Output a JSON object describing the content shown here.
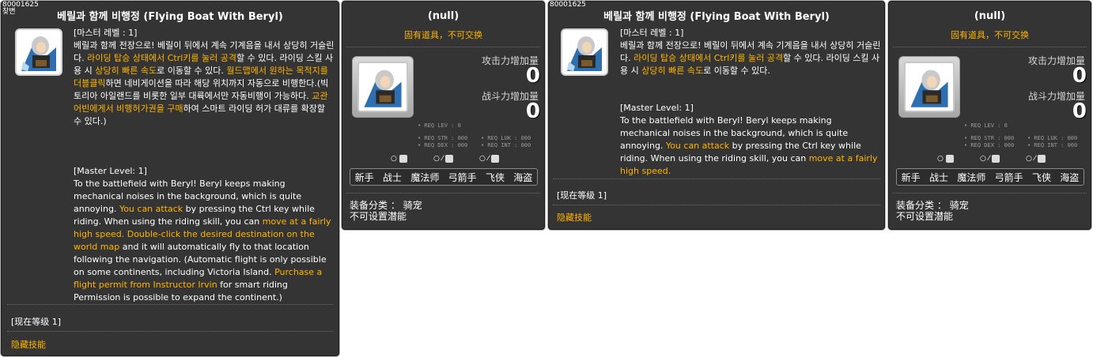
{
  "item_id": "80001625",
  "id_sub": "찾변",
  "skill_name": "베릴과 함께 비행정 (Flying Boat With Beryl)",
  "null_title": "(null)",
  "untradeable": "固有道具，不可交换",
  "desc1": {
    "kr": [
      {
        "t": "[마스터 레벨 : 1]",
        "h": false
      },
      {
        "t": "베릴과 함께 전장으로! 베릴이 뒤에서 계속 기계음을 내서 상당히 거슬린다. ",
        "h": false
      },
      {
        "t": "라이딩 탑승 상태에서 Ctrl키를 눌러 공격",
        "h": true
      },
      {
        "t": "할 수 있다. 라이딩 스킬 사용 시 ",
        "h": false
      },
      {
        "t": "상당히 빠른 속도",
        "h": true
      },
      {
        "t": "로 이동할 수 있다. ",
        "h": false
      },
      {
        "t": "월드맵에서 원하는 목적지를 더블클릭",
        "h": true
      },
      {
        "t": "하면 네비게이션을 따라 해당 위치까지 자동으로 비행한다.(빅토리아 아일랜드를 비롯한 일부 대륙에서만 자동비행이 가능하다. ",
        "h": false
      },
      {
        "t": "교관 어빈에게서 비행허가권을 구매",
        "h": true
      },
      {
        "t": "하여 스마트 라이딩 허가 대류를 확장할 수 있다.)",
        "h": false
      }
    ],
    "en": [
      {
        "t": "[Master Level: 1]",
        "h": false
      },
      {
        "t": "To the battlefield with Beryl! Beryl keeps making mechanical noises in the background, which is quite annoying. ",
        "h": false
      },
      {
        "t": "You can attack",
        "h": true
      },
      {
        "t": " by pressing the Ctrl key while riding. When using the riding skill, you can ",
        "h": false
      },
      {
        "t": "move at a fairly high speed.",
        "h": true
      },
      {
        "t": " ",
        "h": false
      },
      {
        "t": "Double-click the desired destination on the world map",
        "h": true
      },
      {
        "t": " and it will automatically fly to that location following the navigation. (Automatic flight is only possible on some continents, including Victoria Island. ",
        "h": false
      },
      {
        "t": "Purchase a flight permit from Instructor Irvin",
        "h": true
      },
      {
        "t": " for smart riding Permission is possible to expand the continent.)",
        "h": false
      }
    ]
  },
  "desc2": {
    "kr": [
      {
        "t": "[마스터 레벨 : 1]",
        "h": false
      },
      {
        "t": "베릴과 함께 전장으로! 베릴이 뒤에서 계속 기계음을 내서 상당히 거슬린다. ",
        "h": false
      },
      {
        "t": "라이딩 탑승 상태에서 Ctrl키를 눌러 공격",
        "h": true
      },
      {
        "t": "할 수 있다. 라이딩 스킬 사용 시 ",
        "h": false
      },
      {
        "t": "상당히 빠른 속도",
        "h": true
      },
      {
        "t": "로 이동할 수 있다.",
        "h": false
      }
    ],
    "en": [
      {
        "t": "[Master Level: 1]",
        "h": false
      },
      {
        "t": "To the battlefield with Beryl! Beryl keeps making mechanical noises in the background, which is quite annoying. ",
        "h": false
      },
      {
        "t": "You can attack",
        "h": true
      },
      {
        "t": " by pressing the Ctrl key while riding. When using the riding skill, you can ",
        "h": false
      },
      {
        "t": "move at a fairly high speed.",
        "h": true
      }
    ]
  },
  "current_level": "[现在等级 1]",
  "hidden_skill": "隐藏技能",
  "stats": {
    "atk_label": "攻击力增加量",
    "atk_value": "0",
    "power_label": "战斗力增加量",
    "power_value": "0",
    "req_lev": "• REQ LEV :     0",
    "req_str": "• REQ STR : 000",
    "req_luk": "• REQ LUK : 000",
    "req_dex": "• REQ DEX : 000",
    "req_int": "• REQ INT : 000",
    "mini1": "○",
    "mini2": "○ ⁄",
    "mini3": "○ ⁄",
    "jobs": [
      "新手",
      "战士",
      "魔法师",
      "弓箭手",
      "飞侠",
      "海盗"
    ],
    "equip_type": "装备分类 ： 骑宠",
    "no_potential": "不可设置潜能"
  },
  "colors": {
    "panel_bg": "#343434",
    "highlight": "#ffb400",
    "border": "#b9b9b9"
  },
  "icons": [
    "beryl-rider-icon"
  ]
}
